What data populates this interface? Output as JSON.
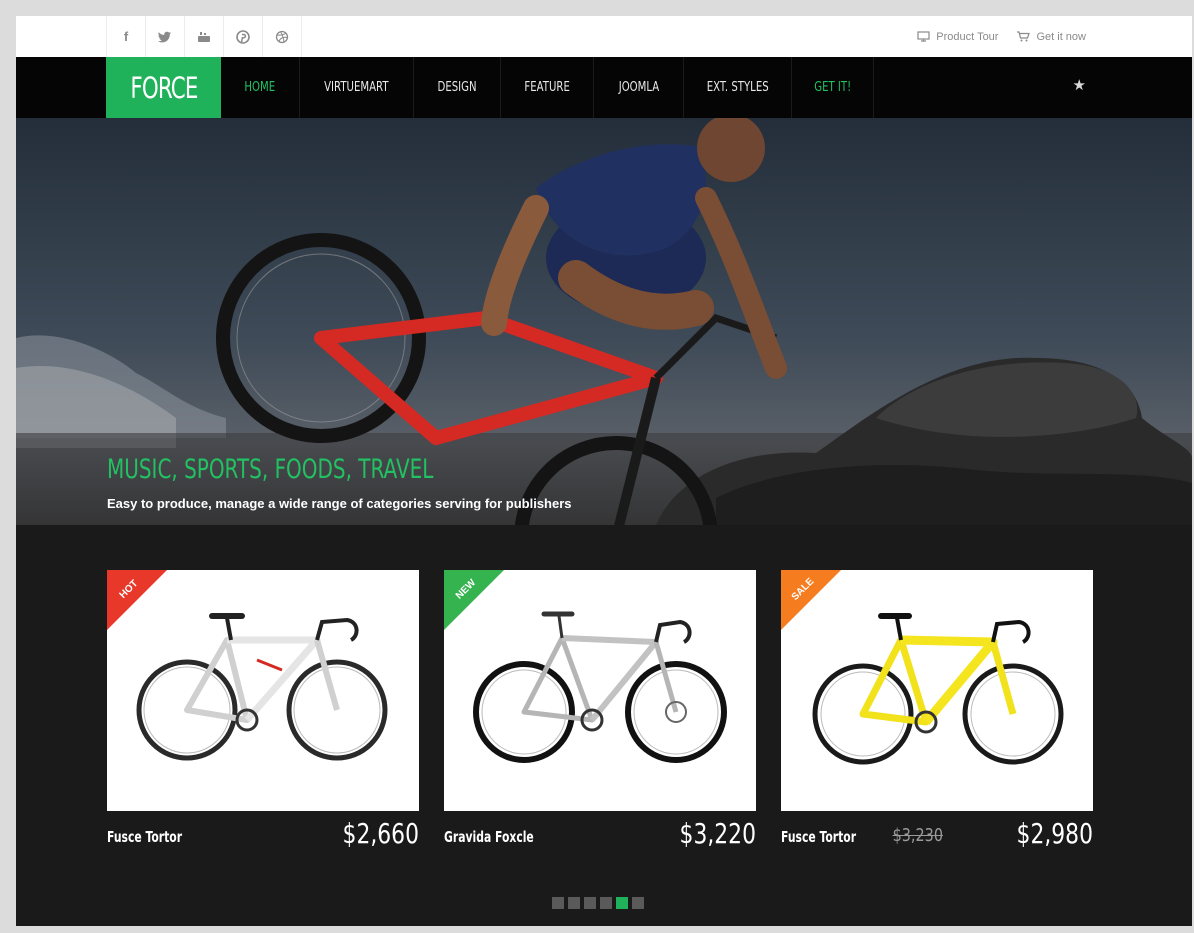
{
  "social": [
    "f",
    "t",
    "yt",
    "p",
    "d"
  ],
  "top_links": {
    "tour": "Product Tour",
    "get": "Get it now"
  },
  "logo": "FORCE",
  "menu": [
    {
      "label": "HOME",
      "active": true
    },
    {
      "label": "VIRTUEMART"
    },
    {
      "label": "DESIGN"
    },
    {
      "label": "FEATURE"
    },
    {
      "label": "JOOMLA"
    },
    {
      "label": "EXT. STYLES"
    },
    {
      "label": "GET IT!",
      "highlight": true
    }
  ],
  "hero": {
    "title": "MUSIC, SPORTS, FOODS, TRAVEL",
    "subtitle": "Easy to produce, manage a wide range of categories serving for publishers"
  },
  "products": [
    {
      "badge": "HOT",
      "badge_color": "#e8382a",
      "name": "Fusce Tortor",
      "price": "$2,660",
      "bike_color": "#cfcfcf"
    },
    {
      "badge": "NEW",
      "badge_color": "#34b34f",
      "name": "Gravida Foxcle",
      "price": "$3,220",
      "bike_color": "#b5b5b5"
    },
    {
      "badge": "SALE",
      "badge_color": "#f57c1f",
      "name": "Fusce Tortor",
      "old_price": "$3,230",
      "price": "$2,980",
      "bike_color": "#f5e51f"
    }
  ],
  "pager": {
    "count": 6,
    "active_index": 4
  },
  "colors": {
    "accent": "#1fb25a",
    "nav_bg": "#050505",
    "products_bg": "#1a1a1a"
  }
}
